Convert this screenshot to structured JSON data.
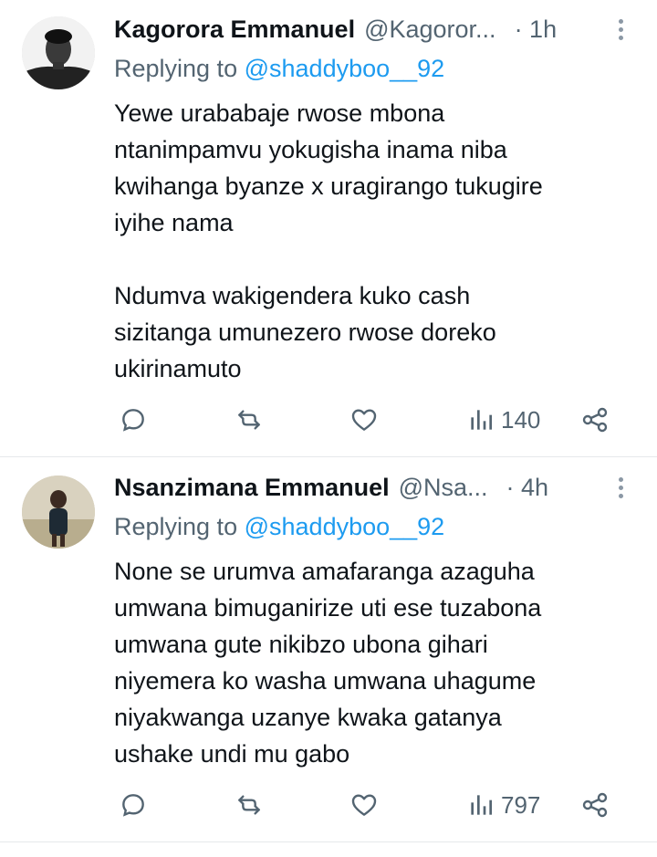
{
  "tweets": [
    {
      "author_name": "Kagorora Emmanuel",
      "handle": "@Kagoror...",
      "time": "· 1h",
      "replying_prefix": "Replying to",
      "replying_to": "@shaddyboo__92",
      "body_lines": [
        "Yewe urababaje rwose mbona",
        "ntanimpamvu yokugisha inama niba",
        "kwihanga byanze x uragirango tukugire",
        "iyihe nama",
        "",
        "Ndumva wakigendera kuko cash",
        "sizitanga umunezero rwose doreko",
        "ukirinamuto"
      ],
      "views": "140"
    },
    {
      "author_name": "Nsanzimana Emmanuel",
      "handle": "@Nsa...",
      "time": "· 4h",
      "replying_prefix": "Replying to",
      "replying_to": "@shaddyboo__92",
      "body_lines": [
        "None se urumva amafaranga azaguha",
        "umwana bimuganirize uti ese tuzabona",
        "umwana gute nikibzo ubona gihari",
        "niyemera ko washa umwana uhagume",
        "niyakwanga uzanye kwaka gatanya",
        "ushake undi mu gabo"
      ],
      "views": "797"
    }
  ],
  "icons": {
    "reply": "speech-bubble-icon",
    "retweet": "retweet-icon",
    "like": "heart-icon",
    "views": "bar-chart-icon",
    "share": "share-icon",
    "more": "more-vertical-icon"
  },
  "colors": {
    "link": "#1d9bf0",
    "secondary_text": "#536471",
    "primary_text": "#0f1419",
    "divider": "#e6e9eb"
  }
}
